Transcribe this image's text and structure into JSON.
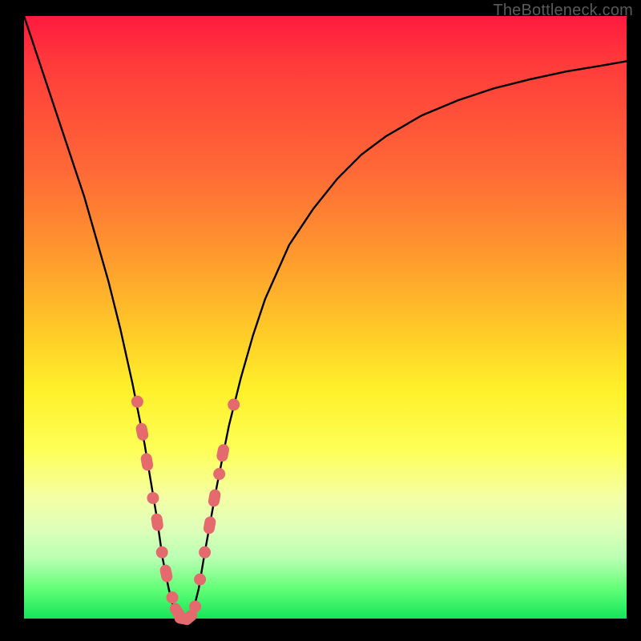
{
  "watermark": "TheBottleneck.com",
  "chart_data": {
    "type": "line",
    "title": "",
    "xlabel": "",
    "ylabel": "",
    "xlim": [
      0,
      100
    ],
    "ylim": [
      0,
      100
    ],
    "grid": false,
    "legend": false,
    "note": "No axis ticks or numeric labels are rendered; x/y are normalized 0–100 across the plot area. Values estimated from pixel positions.",
    "series": [
      {
        "name": "bottleneck-curve",
        "x": [
          0,
          2,
          4,
          6,
          8,
          10,
          12,
          14,
          16,
          18,
          19,
          20,
          21,
          22,
          23,
          24,
          25,
          26,
          27,
          28,
          29,
          30,
          32,
          34,
          36,
          38,
          40,
          44,
          48,
          52,
          56,
          60,
          66,
          72,
          78,
          84,
          90,
          96,
          100
        ],
        "y": [
          100,
          94,
          88,
          82,
          76,
          70,
          63,
          56,
          48,
          39,
          34,
          29,
          23,
          17,
          10,
          5,
          1,
          0,
          0,
          1,
          5,
          11,
          22,
          32,
          40,
          47,
          53,
          62,
          68,
          73,
          77,
          80,
          83.5,
          86,
          88,
          89.5,
          90.8,
          91.8,
          92.5
        ]
      }
    ],
    "markers": {
      "name": "highlighted-points",
      "note": "Salmon dots/segments clustered near the curve minimum. Values estimated.",
      "points": [
        {
          "x": 18.8,
          "y": 36.0,
          "kind": "dot"
        },
        {
          "x": 19.6,
          "y": 31.0,
          "kind": "lozenge"
        },
        {
          "x": 20.4,
          "y": 26.0,
          "kind": "lozenge"
        },
        {
          "x": 21.4,
          "y": 20.0,
          "kind": "dot"
        },
        {
          "x": 22.1,
          "y": 16.0,
          "kind": "lozenge"
        },
        {
          "x": 22.9,
          "y": 11.0,
          "kind": "dot"
        },
        {
          "x": 23.6,
          "y": 7.5,
          "kind": "lozenge"
        },
        {
          "x": 24.6,
          "y": 3.5,
          "kind": "dot"
        },
        {
          "x": 25.4,
          "y": 1.2,
          "kind": "lozenge"
        },
        {
          "x": 26.4,
          "y": 0.0,
          "kind": "lozenge"
        },
        {
          "x": 27.4,
          "y": 0.2,
          "kind": "lozenge"
        },
        {
          "x": 28.4,
          "y": 2.0,
          "kind": "dot"
        },
        {
          "x": 29.2,
          "y": 6.5,
          "kind": "dot"
        },
        {
          "x": 30.0,
          "y": 11.0,
          "kind": "dot"
        },
        {
          "x": 30.8,
          "y": 15.5,
          "kind": "lozenge"
        },
        {
          "x": 31.6,
          "y": 20.0,
          "kind": "lozenge"
        },
        {
          "x": 32.4,
          "y": 24.0,
          "kind": "dot"
        },
        {
          "x": 33.0,
          "y": 27.5,
          "kind": "lozenge"
        },
        {
          "x": 34.8,
          "y": 35.5,
          "kind": "dot"
        }
      ]
    },
    "background_gradient": {
      "top": "#ff1a3f",
      "mid_upper": "#ff9a2e",
      "mid": "#fff02a",
      "mid_lower": "#dfffb8",
      "bottom": "#14e55a"
    }
  }
}
